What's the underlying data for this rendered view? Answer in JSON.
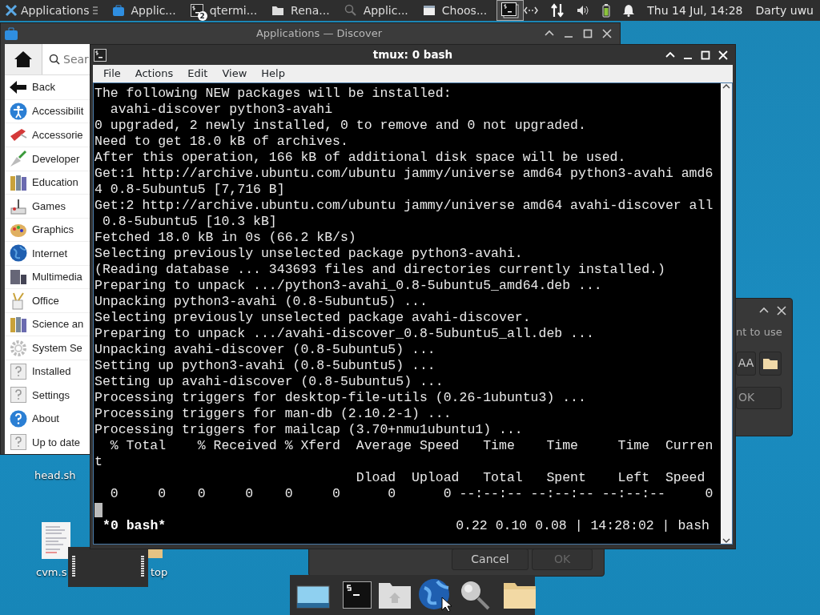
{
  "top_panel": {
    "apps_menu": "Applications",
    "tasks": [
      {
        "label": "Applic...",
        "selected": false
      },
      {
        "label": "qtermi...",
        "badge": "2",
        "selected": false
      },
      {
        "label": "Rena...",
        "selected": false
      },
      {
        "label": "Applic...",
        "selected": false
      },
      {
        "label": "Choos...",
        "selected": false
      },
      {
        "selected": true
      }
    ],
    "clock": "Thu 14 Jul, 14:28",
    "user": "Darty uwu"
  },
  "discover": {
    "title": "Applications — Discover",
    "search_placeholder": "Sear",
    "back": "Back",
    "categories": [
      "Accessibilit",
      "Accessorie",
      "Developer",
      "Education",
      "Games",
      "Graphics",
      "Internet",
      "Multimedia",
      "Office",
      "Science an",
      "System Se"
    ],
    "pages": [
      "Installed",
      "Settings",
      "About",
      "Up to date"
    ]
  },
  "terminal": {
    "title": "tmux: 0 bash",
    "menu": [
      "File",
      "Actions",
      "Edit",
      "View",
      "Help"
    ],
    "lines": [
      "The following NEW packages will be installed:",
      "  avahi-discover python3-avahi",
      "0 upgraded, 2 newly installed, 0 to remove and 0 not upgraded.",
      "Need to get 18.0 kB of archives.",
      "After this operation, 166 kB of additional disk space will be used.",
      "Get:1 http://archive.ubuntu.com/ubuntu jammy/universe amd64 python3-avahi amd6",
      "4 0.8-5ubuntu5 [7,716 B]",
      "Get:2 http://archive.ubuntu.com/ubuntu jammy/universe amd64 avahi-discover all",
      " 0.8-5ubuntu5 [10.3 kB]",
      "Fetched 18.0 kB in 0s (66.2 kB/s)",
      "Selecting previously unselected package python3-avahi.",
      "(Reading database ... 343693 files and directories currently installed.)",
      "Preparing to unpack .../python3-avahi_0.8-5ubuntu5_amd64.deb ...",
      "Unpacking python3-avahi (0.8-5ubuntu5) ...",
      "Selecting previously unselected package avahi-discover.",
      "Preparing to unpack .../avahi-discover_0.8-5ubuntu5_all.deb ...",
      "Unpacking avahi-discover (0.8-5ubuntu5) ...",
      "Setting up python3-avahi (0.8-5ubuntu5) ...",
      "Setting up avahi-discover (0.8-5ubuntu5) ...",
      "Processing triggers for desktop-file-utils (0.26-1ubuntu3) ...",
      "Processing triggers for man-db (2.10.2-1) ...",
      "Processing triggers for mailcap (3.70+nmu1ubuntu1) ...",
      "  % Total    % Received % Xferd  Average Speed   Time    Time     Time  Curren",
      "t",
      "                                 Dload  Upload   Total   Spent    Left  Speed",
      "  0     0    0     0    0     0      0      0 --:--:-- --:--:-- --:--:--     0"
    ],
    "status_left": "*0 bash*",
    "status_right": "0.22 0.10 0.08 | 14:28:02 | bash"
  },
  "dialog_right": {
    "text": "nt to use",
    "font_button": "AA",
    "ok": "OK"
  },
  "dialog_bottom": {
    "cancel": "Cancel",
    "ok": "OK",
    "ok_disabled": true
  },
  "desktop_icons": [
    "head.sh",
    "cvm.s",
    "top"
  ]
}
